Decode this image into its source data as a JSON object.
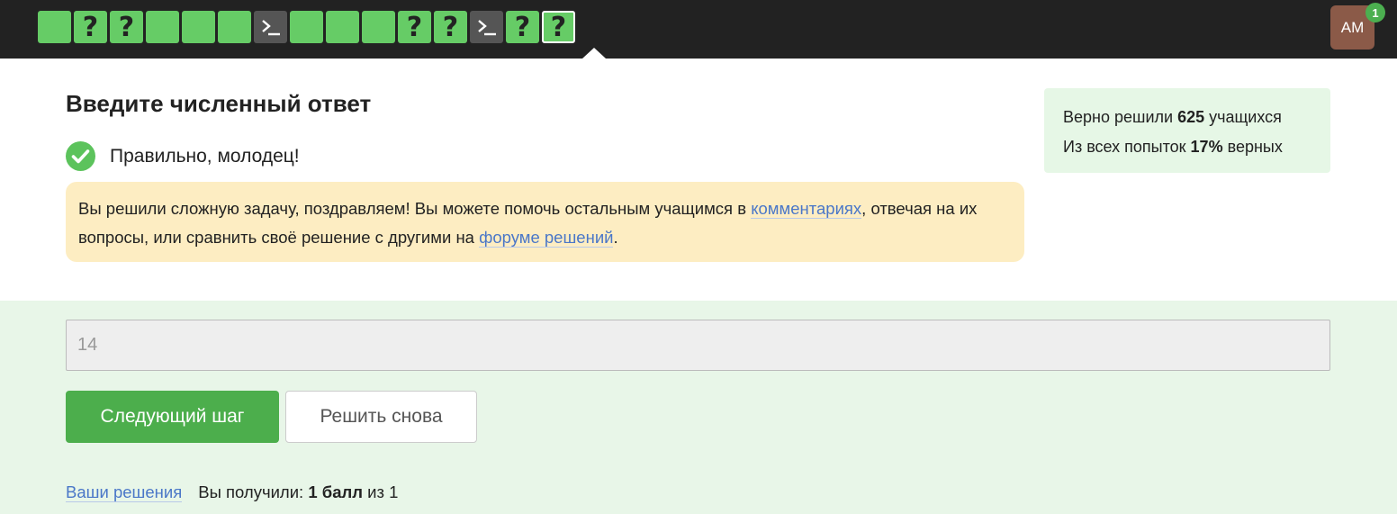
{
  "nav": {
    "steps": [
      {
        "type": "done",
        "label": ""
      },
      {
        "type": "question",
        "label": "?"
      },
      {
        "type": "question",
        "label": "?"
      },
      {
        "type": "done",
        "label": ""
      },
      {
        "type": "done",
        "label": ""
      },
      {
        "type": "done",
        "label": ""
      },
      {
        "type": "terminal",
        "label": ""
      },
      {
        "type": "done",
        "label": ""
      },
      {
        "type": "done",
        "label": ""
      },
      {
        "type": "done",
        "label": ""
      },
      {
        "type": "question",
        "label": "?"
      },
      {
        "type": "question",
        "label": "?"
      },
      {
        "type": "terminal",
        "label": ""
      },
      {
        "type": "question",
        "label": "?"
      },
      {
        "type": "question",
        "label": "?",
        "active": true
      }
    ],
    "avatar_initials": "AM",
    "notification_count": "1"
  },
  "task": {
    "heading": "Введите численный ответ",
    "result_text": "Правильно, молодец!"
  },
  "notice": {
    "text_1": "Вы решили сложную задачу, поздравляем! Вы можете помочь остальным учащимся в ",
    "link_comments": "комментариях",
    "text_2": ", отвечая на их вопросы, или сравнить своё решение с другими на ",
    "link_forum": "форуме решений",
    "text_3": "."
  },
  "stats": {
    "line1_prefix": "Верно решили ",
    "solved_count": "625",
    "line1_suffix": " учащихся",
    "line2_prefix": "Из всех попыток ",
    "percent": "17%",
    "line2_suffix": " верных"
  },
  "answer": {
    "value": "14"
  },
  "buttons": {
    "next_label": "Следующий шаг",
    "retry_label": "Решить снова"
  },
  "footer": {
    "solutions_link": "Ваши решения",
    "score_prefix": "Вы получили: ",
    "score_value": "1 балл",
    "score_suffix": " из 1"
  },
  "colors": {
    "step_done": "#66cc66",
    "step_terminal": "#555555",
    "accent_green": "#4cae4c",
    "notice_bg": "#fdedc2",
    "link": "#4a77c8"
  }
}
